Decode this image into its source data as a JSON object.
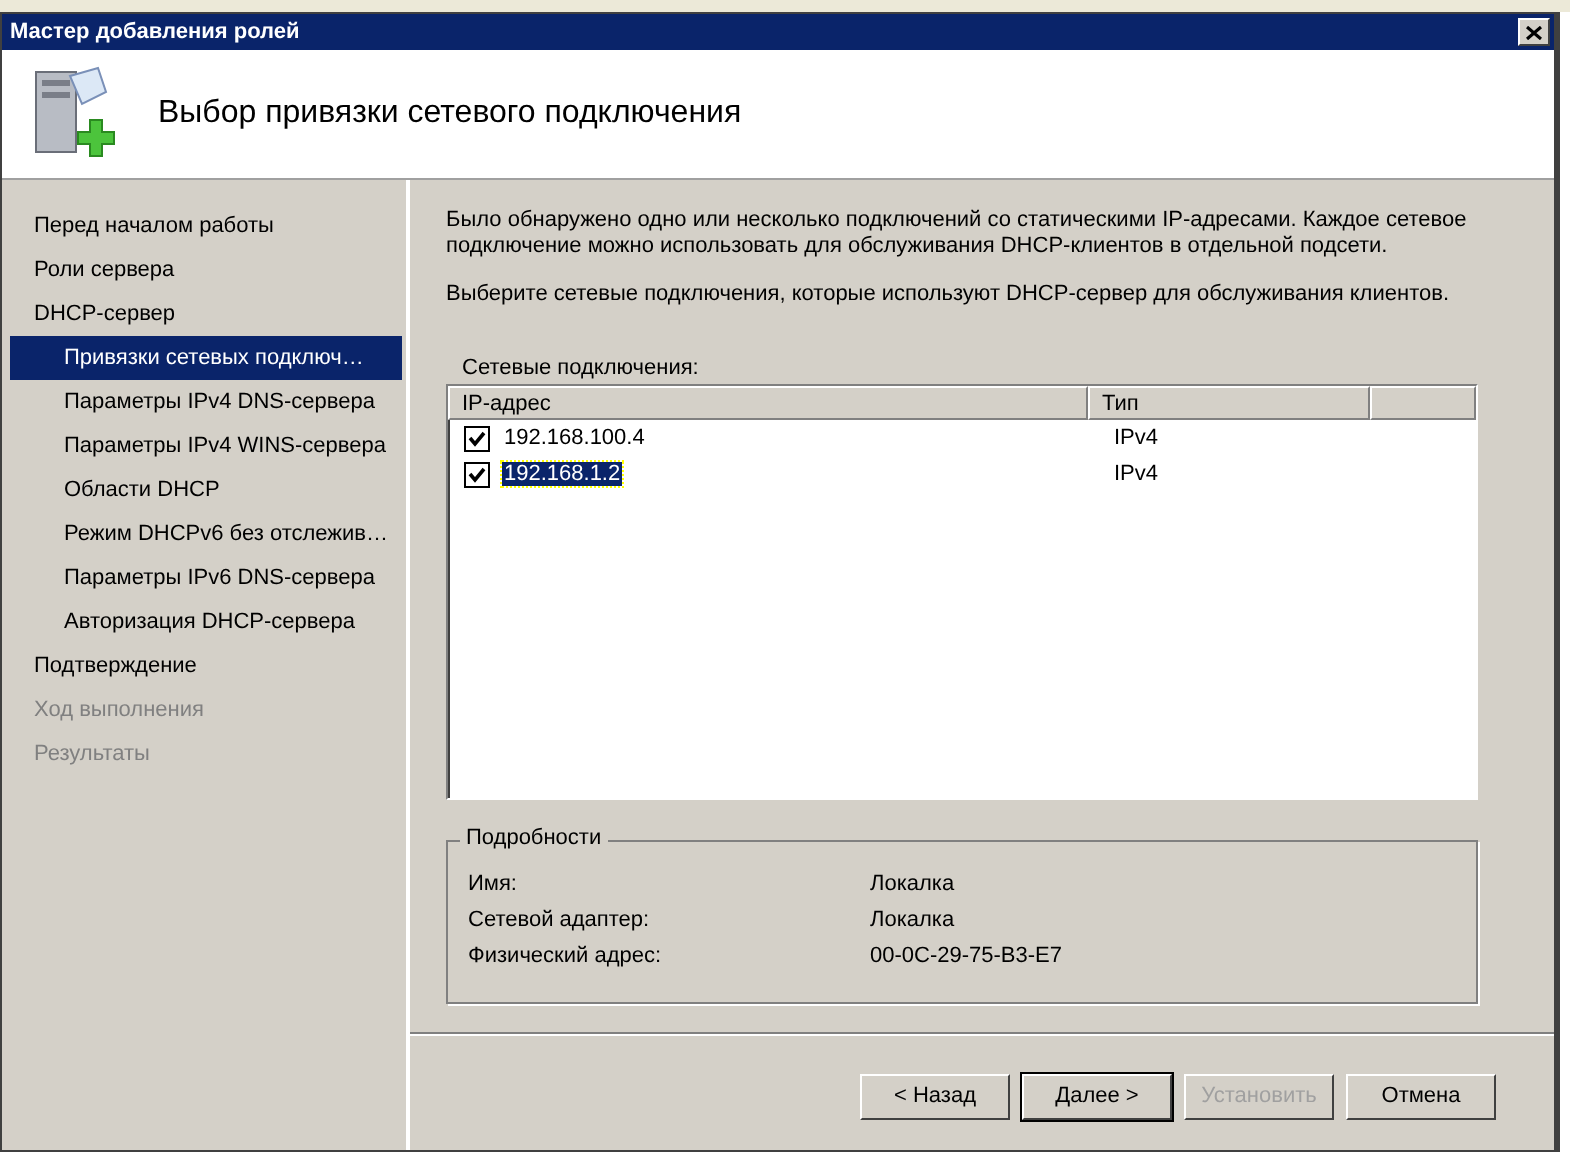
{
  "window": {
    "title": "Мастер добавления ролей"
  },
  "header": {
    "title": "Выбор привязки сетевого подключения"
  },
  "sidebar": {
    "items": [
      {
        "label": "Перед началом работы",
        "selected": false,
        "disabled": false
      },
      {
        "label": "Роли сервера",
        "selected": false,
        "disabled": false
      },
      {
        "label": "DHCP-сервер",
        "selected": false,
        "disabled": false,
        "children": [
          {
            "label": "Привязки сетевых подключ…",
            "selected": true,
            "disabled": false
          },
          {
            "label": "Параметры IPv4 DNS-сервера",
            "selected": false,
            "disabled": false
          },
          {
            "label": "Параметры IPv4 WINS-сервера",
            "selected": false,
            "disabled": false
          },
          {
            "label": "Области DHCP",
            "selected": false,
            "disabled": false
          },
          {
            "label": "Режим DHCPv6 без отслежив…",
            "selected": false,
            "disabled": false
          },
          {
            "label": "Параметры IPv6 DNS-сервера",
            "selected": false,
            "disabled": false
          },
          {
            "label": "Авторизация DHCP-сервера",
            "selected": false,
            "disabled": false
          }
        ]
      },
      {
        "label": "Подтверждение",
        "selected": false,
        "disabled": false
      },
      {
        "label": "Ход выполнения",
        "selected": false,
        "disabled": true
      },
      {
        "label": "Результаты",
        "selected": false,
        "disabled": true
      }
    ]
  },
  "intro": "Было обнаружено одно или несколько подключений со статическими IP-адресами. Каждое сетевое подключение можно использовать для обслуживания DHCP-клиентов в отдельной подсети.",
  "instruction": "Выберите сетевые подключения, которые используют DHCP-сервер для обслуживания клиентов.",
  "connections": {
    "label": "Сетевые подключения:",
    "columns": [
      "IP-адрес",
      "Тип"
    ],
    "rows": [
      {
        "ip": "192.168.100.4",
        "type": "IPv4",
        "checked": true,
        "selected": false
      },
      {
        "ip": "192.168.1.2",
        "type": "IPv4",
        "checked": true,
        "selected": true
      }
    ]
  },
  "details": {
    "title": "Подробности",
    "fields": [
      {
        "label": "Имя:",
        "value": "Локалка"
      },
      {
        "label": "Сетевой адаптер:",
        "value": "Локалка"
      },
      {
        "label": "Физический адрес:",
        "value": "00-0C-29-75-B3-E7"
      }
    ]
  },
  "buttons": [
    {
      "label": "< Назад",
      "disabled": false,
      "default": false
    },
    {
      "label": "Далее >",
      "disabled": false,
      "default": true
    },
    {
      "label": "Установить",
      "disabled": true,
      "default": false
    },
    {
      "label": "Отмена",
      "disabled": false,
      "default": false
    }
  ]
}
